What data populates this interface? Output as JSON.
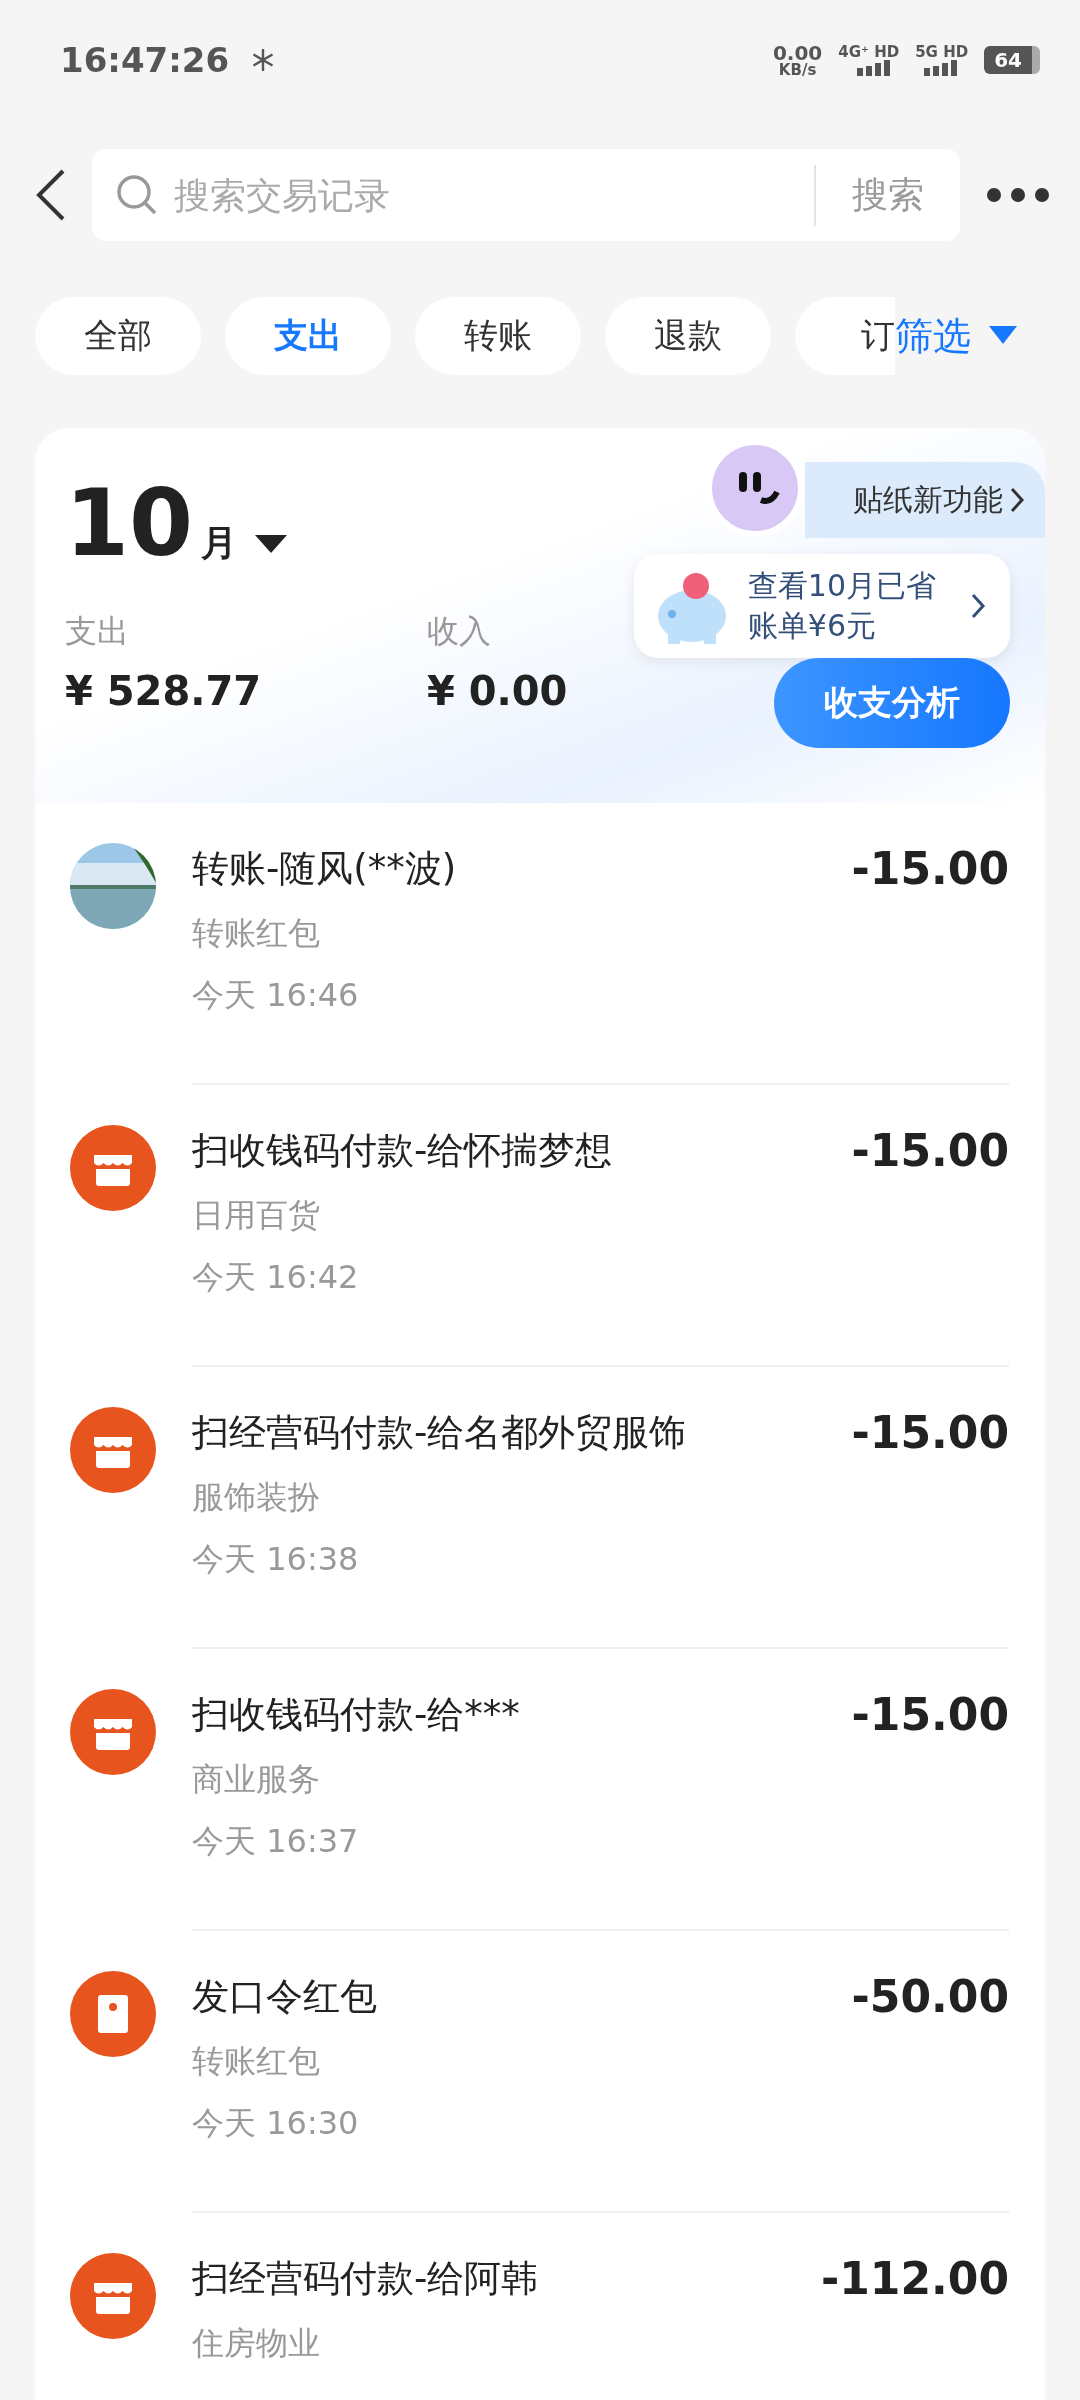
{
  "status_bar": {
    "time": "16:47:26",
    "speed": "0.00",
    "speed_unit": "KB/s",
    "sim1": "4G⁺ HD",
    "sim2": "5G HD",
    "battery": "64"
  },
  "search": {
    "placeholder": "搜索交易记录",
    "button": "搜索"
  },
  "filters": [
    {
      "label": "全部",
      "selected": false
    },
    {
      "label": "支出",
      "selected": true
    },
    {
      "label": "转账",
      "selected": false
    },
    {
      "label": "退款",
      "selected": false
    },
    {
      "label": "订",
      "selected": false
    }
  ],
  "filter_button": "筛选",
  "summary": {
    "month": "10",
    "month_unit": "月",
    "sticker": "贴纸新功能",
    "tip_line1": "查看10月已省",
    "tip_line2": "账单¥6元",
    "expense_label": "支出",
    "expense": "¥ 528.77",
    "income_label": "收入",
    "income": "¥ 0.00",
    "analysis_button": "收支分析"
  },
  "transactions": [
    {
      "title": "转账-随风(**波)",
      "category": "转账红包",
      "time": "今天 16:46",
      "amount": "-15.00"
    },
    {
      "kind": "shop",
      "title": "扫收钱码付款-给怀揣梦想",
      "category": "日用百货",
      "time": "今天 16:42",
      "amount": "-15.00"
    },
    {
      "kind": "shop",
      "title": "扫经营码付款-给名都外贸服饰",
      "category": "服饰装扮",
      "time": "今天 16:38",
      "amount": "-15.00"
    },
    {
      "kind": "shop",
      "title": "扫收钱码付款-给***",
      "category": "商业服务",
      "time": "今天 16:37",
      "amount": "-15.00"
    },
    {
      "kind": "redpacket",
      "title": "发口令红包",
      "category": "转账红包",
      "time": "今天 16:30",
      "amount": "-50.00"
    },
    {
      "kind": "shop",
      "title": "扫经营码付款-给阿韩",
      "category": "住房物业",
      "amount": "-112.00"
    }
  ]
}
